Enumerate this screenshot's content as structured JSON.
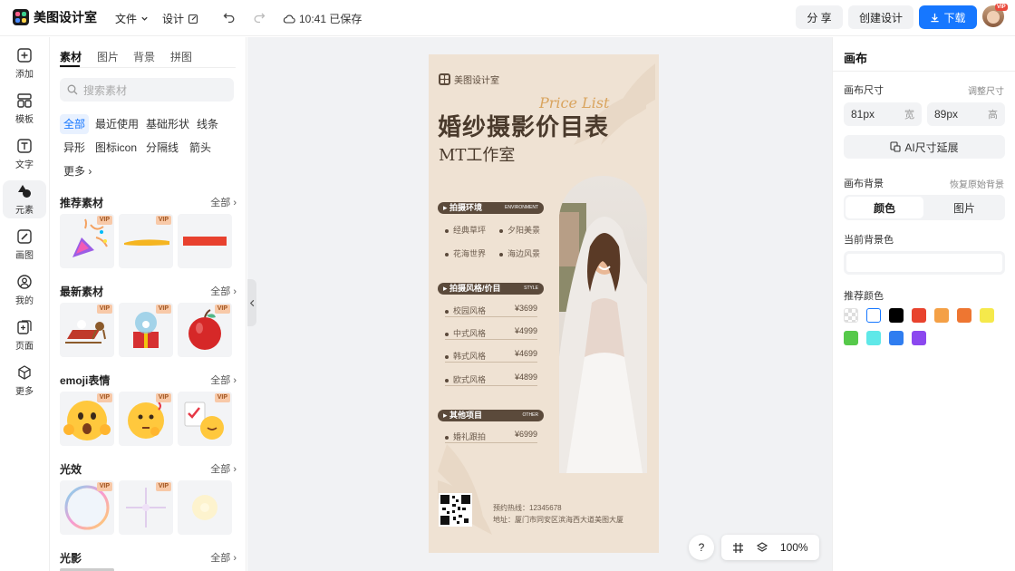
{
  "topbar": {
    "app_name": "美图设计室",
    "menu_file": "文件",
    "menu_design": "设计",
    "save_status": "10:41 已保存",
    "share_label": "分 享",
    "create_label": "创建设计",
    "download_label": "下载",
    "avatar_badge": "VIP"
  },
  "rail": {
    "items": [
      {
        "label": "添加",
        "icon": "plus-square-icon"
      },
      {
        "label": "模板",
        "icon": "template-icon"
      },
      {
        "label": "文字",
        "icon": "text-icon"
      },
      {
        "label": "元素",
        "icon": "shapes-icon"
      },
      {
        "label": "画图",
        "icon": "draw-icon"
      },
      {
        "label": "我的",
        "icon": "user-icon"
      },
      {
        "label": "页面",
        "icon": "page-add-icon"
      },
      {
        "label": "更多",
        "icon": "cube-icon"
      }
    ]
  },
  "panel": {
    "tabs": [
      "素材",
      "图片",
      "背景",
      "拼图"
    ],
    "search_placeholder": "搜索素材",
    "chips": [
      "全部",
      "最近使用",
      "基础形状",
      "线条",
      "异形",
      "图标icon",
      "分隔线",
      "箭头",
      "更多"
    ],
    "sections": [
      {
        "title": "推荐素材",
        "all": "全部"
      },
      {
        "title": "最新素材",
        "all": "全部"
      },
      {
        "title": "emoji表情",
        "all": "全部"
      },
      {
        "title": "光效",
        "all": "全部"
      },
      {
        "title": "光影",
        "all": "全部"
      }
    ],
    "vip_badge": "VIP"
  },
  "poster": {
    "brand": "美图设计室",
    "script_text": "Price List",
    "title": "婚纱摄影价目表",
    "subtitle": "MT工作室",
    "section1": "拍摄环境",
    "section1_tag": "ENVIRONMENT",
    "env_items": [
      "经典草坪",
      "夕阳美景",
      "花海世界",
      "海边风景"
    ],
    "section2": "拍摄风格/价目",
    "section2_tag": "STYLE",
    "styles": [
      {
        "name": "校园风格",
        "price": "¥3699"
      },
      {
        "name": "中式风格",
        "price": "¥4999"
      },
      {
        "name": "韩式风格",
        "price": "¥4699"
      },
      {
        "name": "欧式风格",
        "price": "¥4899"
      }
    ],
    "section3": "其他项目",
    "section3_tag": "OTHER",
    "other_items": [
      {
        "name": "婚礼跟拍",
        "price": "¥6999"
      }
    ],
    "phone": "预约热线：12345678",
    "address": "地址：厦门市同安区滨海西大道美图大厦"
  },
  "right": {
    "title": "画布",
    "size_label": "画布尺寸",
    "size_hint": "调整尺寸",
    "width_value": "81px",
    "width_unit": "宽",
    "height_value": "89px",
    "height_unit": "高",
    "ai_expand": "AI尺寸延展",
    "bg_label": "画布背景",
    "bg_hint": "恢复原始背景",
    "seg_color": "颜色",
    "seg_image": "图片",
    "current_bg": "当前背景色",
    "recommended": "推荐颜色",
    "colors": [
      "transparent",
      "#ffffff",
      "#000000",
      "#e8432e",
      "#f4a046",
      "#ee7631",
      "#f5e94b",
      "#56c94a",
      "#5fe8e8",
      "#2f7df0",
      "#8b48ef"
    ]
  },
  "bottom": {
    "help": "?",
    "zoom": "100%"
  }
}
